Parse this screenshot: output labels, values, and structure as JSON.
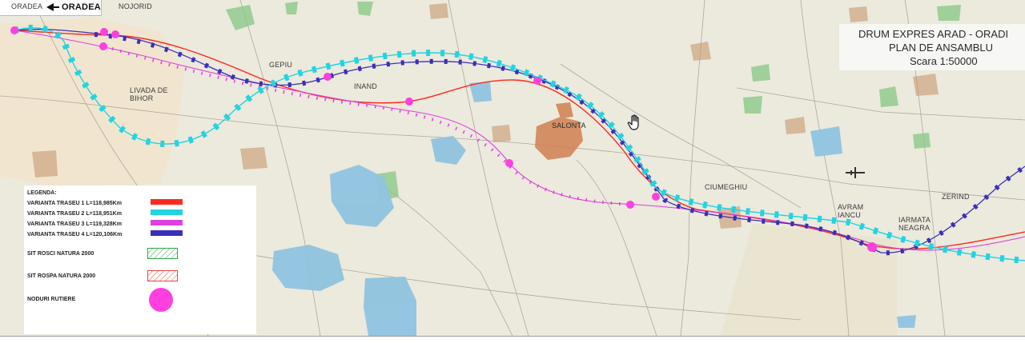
{
  "title": {
    "line1": "DRUM EXPRES ARAD - ORADI",
    "line2": "PLAN DE ANSAMBLU",
    "line3": "Scara 1:50000"
  },
  "places": {
    "oradea_small": "ORADEA",
    "oradea_arrow": "ORADEA",
    "nojorid": "NOJORID",
    "gepiu": "GEPIU",
    "inand": "INAND",
    "livada": "LIVADA DE",
    "bihor": "BIHOR",
    "salonta": "SALONTA",
    "ciumeghiu": "CIUMEGHIU",
    "avram": "AVRAM",
    "iancu": "IANCU",
    "zerind": "ZERIND",
    "iarmata": "IARMATA",
    "neagra": "NEAGRA"
  },
  "legend": {
    "title": "LEGENDA:",
    "items": [
      {
        "label": "VARIANTA TRASEU 1 L=118,985Km",
        "color": "#ff2a1a"
      },
      {
        "label": "VARIANTA TRASEU 2 L=118,951Km",
        "color": "#22d3e0"
      },
      {
        "label": "VARIANTA TRASEU 3 L=119,328Km",
        "color": "#e040e0"
      },
      {
        "label": "VARIANTA TRASEU 4 L=120,106Km",
        "color": "#3a2fb8"
      }
    ],
    "rosci": "SIT ROSCI NATURA 2000",
    "rospa": "SIT ROSPA NATURA 2000",
    "noduri": "NODURI RUTIERE",
    "rosci_color": "#2ea84a",
    "rospa_color": "#e4493a",
    "node_color": "#ff3fe0"
  },
  "colors": {
    "map_bg": "#ece9dd",
    "urban": "#d08050",
    "water": "#8fc4e0",
    "forest": "#8cc98a"
  },
  "icons": {
    "cursor": "hand-cursor-icon",
    "airplane": "airplane-icon",
    "arrow": "arrow-left-icon"
  }
}
